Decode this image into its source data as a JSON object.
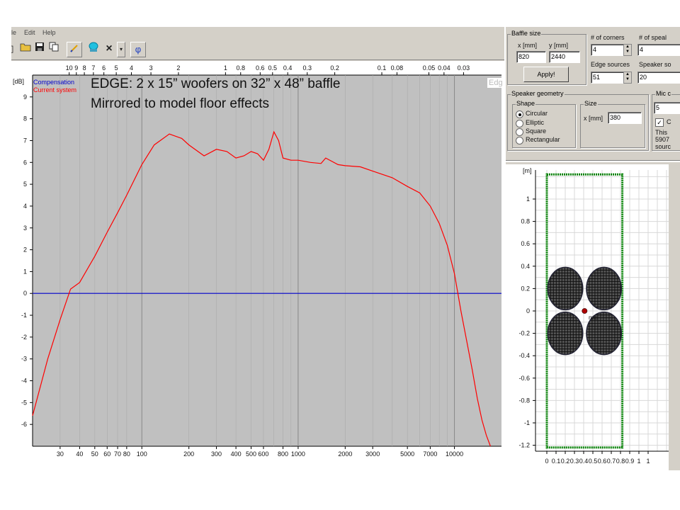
{
  "menu": {
    "file": "le",
    "edit": "Edit",
    "help": "Help"
  },
  "toolbar_icons": [
    "document-icon",
    "open-folder-icon",
    "save-disk-icon",
    "copy-icon",
    "pen-icon",
    "speaker-icon",
    "close-x-icon",
    "dropdown-arrow-icon",
    "phi-icon"
  ],
  "toolbar_glyph_phi": "φ",
  "main_plot": {
    "y_unit": "[dB]",
    "legend": [
      {
        "name": "Compensation",
        "color": "#0000cc"
      },
      {
        "name": "Current system",
        "color": "#ff0000"
      }
    ],
    "corner_label": "Edg",
    "annotation_line1": "EDGE: 2 x 15” woofers on 32” x 48” baffle",
    "annotation_line2": "Mirrored to model floor effects",
    "top_ticks": [
      "10",
      "9",
      "8",
      "7",
      "6",
      "5",
      "4",
      "3",
      "2",
      "1",
      "0.8",
      "0.6",
      "0.5",
      "0.4",
      "0.3",
      "0.2",
      "0.1",
      "0.08",
      "0.05",
      "0.04",
      "0.03"
    ],
    "y_ticks": [
      "9",
      "8",
      "7",
      "6",
      "5",
      "4",
      "3",
      "2",
      "1",
      "0",
      "-1",
      "-2",
      "-3",
      "-4",
      "-5",
      "-6"
    ],
    "x_ticks": [
      "30",
      "40",
      "50",
      "60",
      "70",
      "80",
      "100",
      "200",
      "300",
      "400",
      "500",
      "600",
      "800",
      "1000",
      "2000",
      "3000",
      "5000",
      "7000",
      "10000"
    ]
  },
  "chart_data": {
    "type": "line",
    "x_scale": "log",
    "xlim": [
      20,
      20000
    ],
    "ylim": [
      -7,
      10
    ],
    "ylabel": "[dB]",
    "grid": true,
    "legend_position": "top-left",
    "series": [
      {
        "name": "Compensation",
        "color": "#0000cc",
        "x": [
          20,
          20000
        ],
        "y": [
          0,
          0
        ]
      },
      {
        "name": "Current system",
        "color": "#ff0000",
        "x": [
          20,
          25,
          30,
          35,
          40,
          50,
          60,
          70,
          80,
          100,
          120,
          150,
          180,
          200,
          250,
          300,
          350,
          400,
          450,
          500,
          550,
          600,
          650,
          700,
          750,
          800,
          900,
          1000,
          1200,
          1400,
          1500,
          1800,
          2000,
          2500,
          3000,
          4000,
          5000,
          6000,
          7000,
          8000,
          9000,
          10000,
          11000,
          12000,
          13000,
          14000,
          15000,
          16000,
          17000
        ],
        "y": [
          -5.6,
          -3.0,
          -1.2,
          0.2,
          0.5,
          1.7,
          2.8,
          3.7,
          4.5,
          5.9,
          6.8,
          7.3,
          7.1,
          6.8,
          6.3,
          6.6,
          6.5,
          6.2,
          6.3,
          6.5,
          6.4,
          6.1,
          6.6,
          7.4,
          7.0,
          6.2,
          6.1,
          6.1,
          6.0,
          5.95,
          6.2,
          5.9,
          5.85,
          5.8,
          5.6,
          5.3,
          4.9,
          4.6,
          4.0,
          3.2,
          2.2,
          0.9,
          -0.8,
          -2.2,
          -3.5,
          -4.8,
          -5.8,
          -6.5,
          -7.0
        ]
      }
    ]
  },
  "baffle_size": {
    "label": "Baffle size",
    "x_label": "x [mm]",
    "y_label": "y [mm]",
    "x_value": "820",
    "y_value": "2440",
    "apply_label": "Apply!"
  },
  "corners": {
    "label": "# of corners",
    "value": "4"
  },
  "speakers": {
    "label": "# of speal",
    "value": "4"
  },
  "edge_sources": {
    "label": "Edge sources",
    "value": "51"
  },
  "speaker_sources": {
    "label": "Speaker so",
    "value": "20"
  },
  "speaker_geometry": {
    "label": "Speaker geometry",
    "shape_label": "Shape",
    "options": [
      "Circular",
      "Elliptic",
      "Square",
      "Rectangular"
    ],
    "selected": "Circular",
    "size_label": "Size",
    "size_x_label": "x [mm]",
    "size_value": "380"
  },
  "mic": {
    "label": "Mic c",
    "value": "5",
    "checkbox_mark": "✓",
    "checkbox_label": "C",
    "info_line1": "This",
    "info_line2": "5907",
    "info_line3": "sourc"
  },
  "baffle_plot": {
    "unit": "[m]",
    "y_ticks": [
      "1",
      "0.8",
      "0.6",
      "0.4",
      "0.2",
      "0",
      "-0.2",
      "-0.4",
      "-0.6",
      "-0.8",
      "-1",
      "-1.2"
    ],
    "x_ticks": [
      "0",
      "0.1",
      "0.2",
      "0.3",
      "0.4",
      "0.5",
      "0.6",
      "0.7",
      "0.8",
      "0.9",
      "1",
      "1"
    ],
    "mic_label": "mic"
  }
}
